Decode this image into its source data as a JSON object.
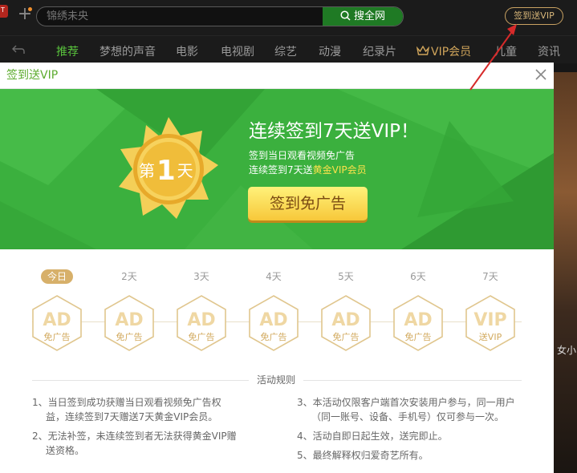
{
  "topbar": {
    "logo_text": "T",
    "search_placeholder": "锦绣未央",
    "search_button": "搜全网",
    "signin_vip_button": "签到送VIP"
  },
  "nav": {
    "items": [
      "推荐",
      "梦想的声音",
      "电影",
      "电视剧",
      "综艺",
      "动漫",
      "纪录片",
      "VIP会员",
      "儿童",
      "资讯"
    ],
    "active": "推荐"
  },
  "dialog": {
    "title": "签到送VIP",
    "banner": {
      "medal_prefix": "第",
      "medal_number": "1",
      "medal_suffix": "天",
      "title": "连续签到7天送VIP！",
      "line1": "签到当日观看视频免广告",
      "line2_prefix": "连续签到7天送",
      "line2_highlight": "黄金VIP会员",
      "button": "签到免广告"
    },
    "days": [
      {
        "label": "今日",
        "top": "AD",
        "bottom": "免广告"
      },
      {
        "label": "2天",
        "top": "AD",
        "bottom": "免广告"
      },
      {
        "label": "3天",
        "top": "AD",
        "bottom": "免广告"
      },
      {
        "label": "4天",
        "top": "AD",
        "bottom": "免广告"
      },
      {
        "label": "5天",
        "top": "AD",
        "bottom": "免广告"
      },
      {
        "label": "6天",
        "top": "AD",
        "bottom": "免广告"
      },
      {
        "label": "7天",
        "top": "VIP",
        "bottom": "送VIP"
      }
    ],
    "rules_title": "活动规则",
    "rules": [
      "1、当日签到成功获赠当日观看视频免广告权",
      "益，连续签到7天赠送7天黄金VIP会员。",
      "2、无法补签，未连续签到者无法获得黄金VIP赠",
      "送资格。",
      "3、本活动仅限客户端首次安装用户参与，同一用户",
      "（同一账号、设备、手机号）仅可参与一次。",
      "4、活动自即日起生效，送完即止。",
      "5、最终解释权归爱奇艺所有。"
    ]
  },
  "background": {
    "side_text": "女小"
  },
  "colors": {
    "accent_green": "#3bb03e",
    "gold": "#d7b06a",
    "nav_active": "#59c23d"
  }
}
